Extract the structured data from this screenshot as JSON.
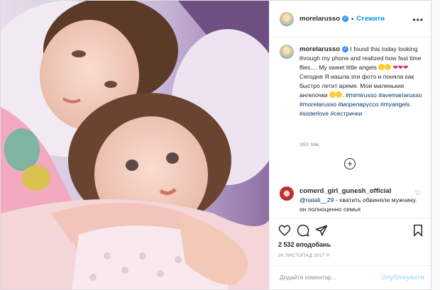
{
  "post": {
    "username": "morelarusso",
    "follow_label": "Стежити",
    "more_glyph": "•••",
    "caption": {
      "username": "morelarusso",
      "text1": "I found this today looking through my phone and realized how fast time flies.... My sweet little angels",
      "text2": "Сегодня Я нашла эти фото и поняла как быстро летит время. Мои маленькие ангелочки",
      "tags": [
        "#mimirusso",
        "#avemariarusso",
        "#morelarusso",
        "#морелaрyccо",
        "#myangels",
        "#sisterlove",
        "#сестрички"
      ]
    },
    "time_ago": "163 тиж.",
    "load_more_glyph": "+",
    "comment": {
      "username": "comerd_girl_gunesh_official",
      "mention": "@natali__29",
      "text": "- хватить обвиняли мужчину. он полноценно семья"
    },
    "likes": "2 532 вподобань",
    "date": "26 ЛИСТОПАД 2017 Р.",
    "add_comment_placeholder": "Додайте коментар...",
    "publish_label": "Опублікувати"
  },
  "icons": {
    "verified": "verified-badge-icon",
    "like": "heart-icon",
    "comment": "comment-icon",
    "share": "share-icon",
    "save": "bookmark-icon",
    "add": "plus-circle-icon"
  },
  "colors": {
    "accent": "#0095f6",
    "link": "#00376b",
    "muted": "#8e8e8e",
    "heart": "#e0245e"
  }
}
